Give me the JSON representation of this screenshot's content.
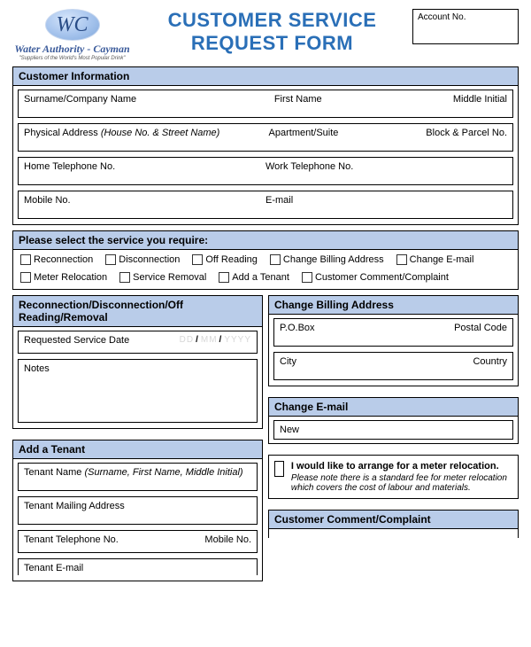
{
  "header": {
    "logo_monogram": "WC",
    "org_name": "Water Authority - Cayman",
    "slogan": "\"Suppliers of the World's Most Popular Drink\"",
    "title_line1": "CUSTOMER SERVICE",
    "title_line2": "REQUEST FORM",
    "account_label": "Account No."
  },
  "customer_info": {
    "heading": "Customer Information",
    "surname_label": "Surname/Company Name",
    "firstname_label": "First Name",
    "middle_label": "Middle Initial",
    "address_label": "Physical Address ",
    "address_hint": "(House No. & Street Name)",
    "apt_label": "Apartment/Suite",
    "block_label": "Block & Parcel No.",
    "home_tel_label": "Home Telephone No.",
    "work_tel_label": "Work Telephone No.",
    "mobile_label": "Mobile No.",
    "email_label": "E-mail"
  },
  "service_select": {
    "heading": "Please select the service you require:",
    "options": {
      "reconnection": "Reconnection",
      "disconnection": "Disconnection",
      "off_reading": "Off Reading",
      "change_billing": "Change Billing Address",
      "change_email": "Change E-mail",
      "meter_relocation": "Meter Relocation",
      "service_removal": "Service Removal",
      "add_tenant": "Add a Tenant",
      "comment": "Customer Comment/Complaint"
    }
  },
  "left": {
    "recon_heading": "Reconnection/Disconnection/Off Reading/Removal",
    "req_date_label": "Requested Service Date",
    "date_dd": "DD",
    "date_mm": "MM",
    "date_yyyy": "YYYY",
    "notes_label": "Notes",
    "add_tenant_heading": "Add a Tenant",
    "tenant_name_label": "Tenant Name ",
    "tenant_name_hint": "(Surname, First Name, Middle Initial)",
    "tenant_mail_label": "Tenant Mailing Address",
    "tenant_tel_label": "Tenant Telephone No.",
    "tenant_mobile_label": "Mobile No.",
    "tenant_email_label": "Tenant E-mail"
  },
  "right": {
    "billing_heading": "Change Billing Address",
    "pobox_label": "P.O.Box",
    "postal_label": "Postal Code",
    "city_label": "City",
    "country_label": "Country",
    "email_heading": "Change E-mail",
    "new_label": "New",
    "meter_bold": "I would like to arrange for a meter relocation.",
    "meter_note": "Please note there is a standard fee for meter relocation which covers the cost of labour and materials.",
    "comment_heading": "Customer Comment/Complaint"
  }
}
